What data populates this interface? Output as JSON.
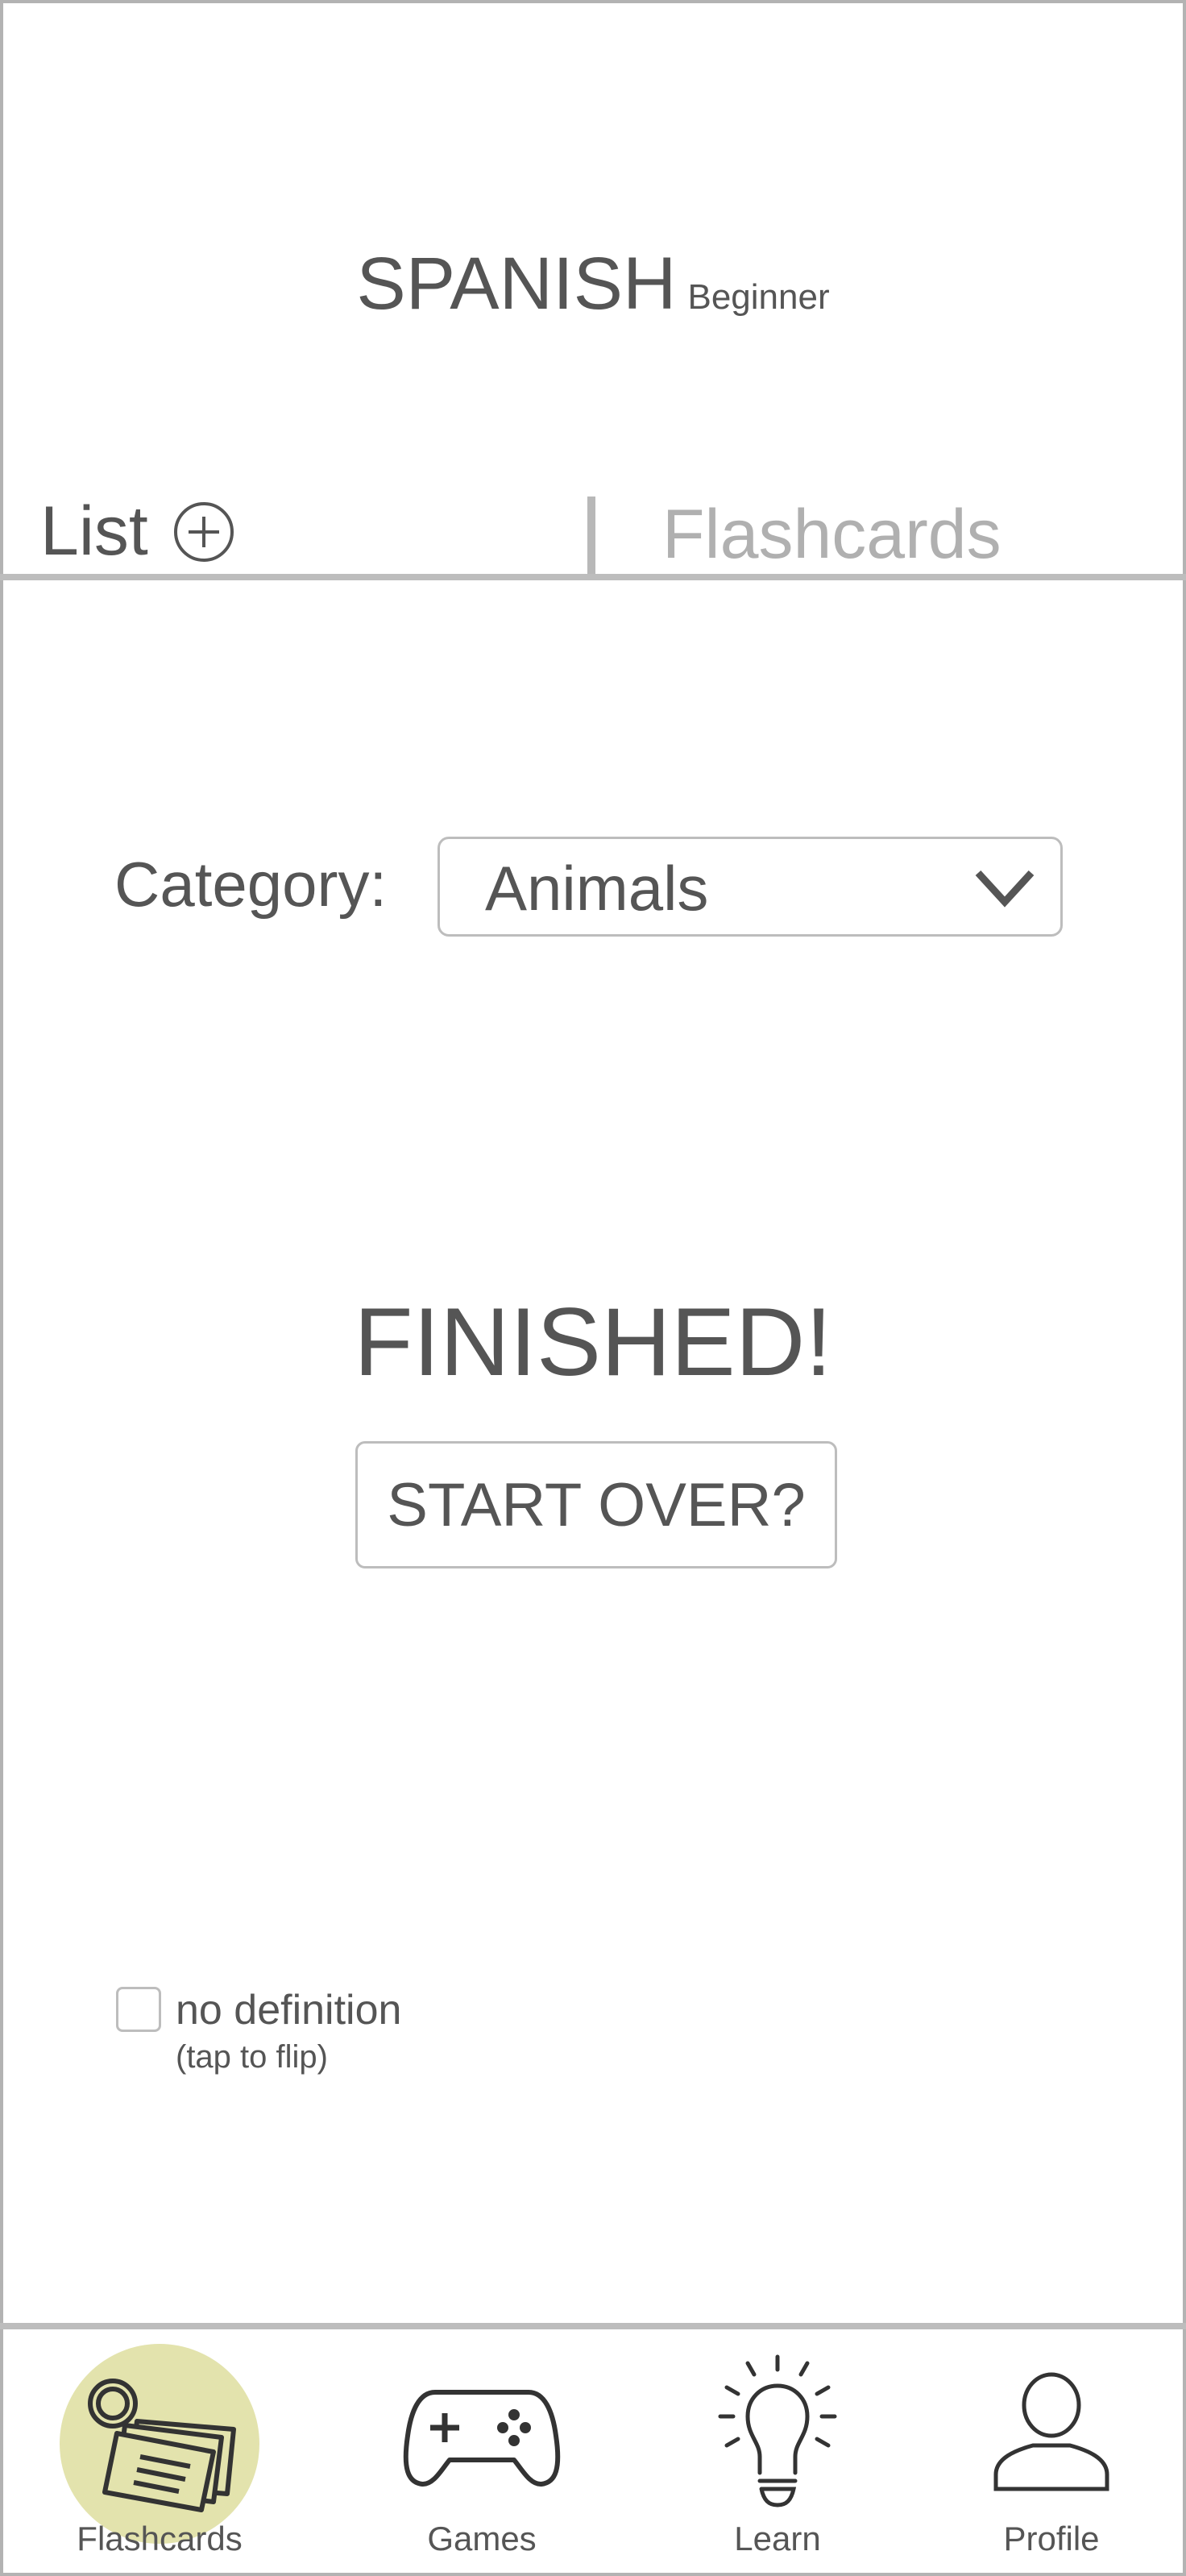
{
  "header": {
    "language": "SPANISH",
    "level": "Beginner"
  },
  "tabs": {
    "list_label": "List",
    "flashcards_label": "Flashcards",
    "active": "List"
  },
  "category": {
    "label": "Category:",
    "selected": "Animals"
  },
  "status": {
    "message": "FINISHED!",
    "start_over_label": "START OVER?"
  },
  "options": {
    "no_definition_label": "no definition",
    "no_definition_hint": "(tap to flip)",
    "no_definition_checked": false
  },
  "bottom_nav": {
    "items": [
      {
        "label": "Flashcards",
        "icon": "flashcards-icon",
        "active": true
      },
      {
        "label": "Games",
        "icon": "gamepad-icon",
        "active": false
      },
      {
        "label": "Learn",
        "icon": "lightbulb-icon",
        "active": false
      },
      {
        "label": "Profile",
        "icon": "user-icon",
        "active": false
      }
    ]
  },
  "colors": {
    "text": "#555555",
    "muted": "#b0b0b0",
    "border": "#bdbdbd",
    "active_nav_bg": "#e3e3ad"
  }
}
